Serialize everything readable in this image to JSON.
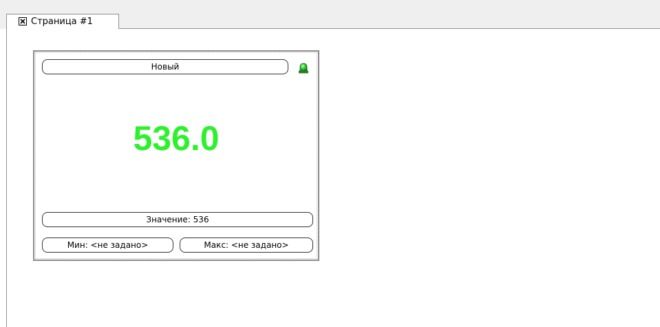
{
  "tab": {
    "title": "Страница #1",
    "close_icon": "close-x-icon"
  },
  "widget": {
    "title": "Новый",
    "status_icon": "green-led-icon",
    "status_color": "#22c022",
    "value_display": "536.0",
    "value_color": "#2ef12e",
    "value_label": "Значение: 536",
    "min_label": "Мин: <не задано>",
    "max_label": "Макс: <не задано>"
  }
}
